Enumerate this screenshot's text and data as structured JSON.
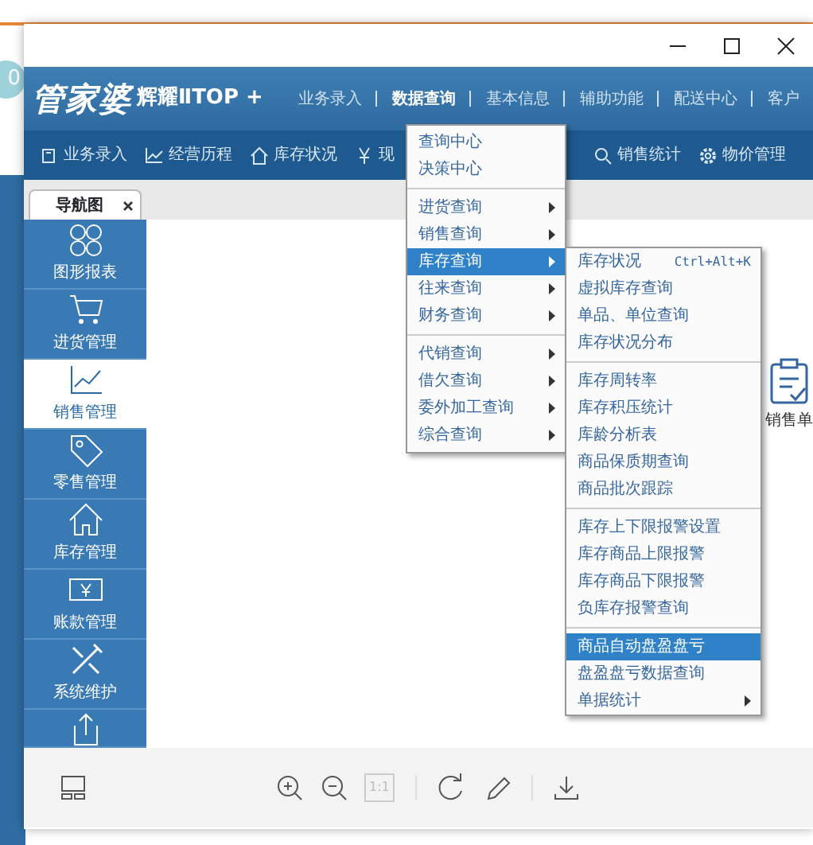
{
  "background": {
    "badge": "0"
  },
  "app": {
    "brand": "管家婆",
    "edition": "辉耀ⅡTOP +",
    "top_menu": [
      {
        "label": "业务录入",
        "selected": false
      },
      {
        "label": "数据查询",
        "selected": true
      },
      {
        "label": "基本信息",
        "selected": false
      },
      {
        "label": "辅助功能",
        "selected": false
      },
      {
        "label": "配送中心",
        "selected": false
      },
      {
        "label": "客户",
        "selected": false
      }
    ],
    "toolbar": [
      {
        "label": "业务录入",
        "kind": "entry"
      },
      {
        "label": "经营历程",
        "kind": "chart"
      },
      {
        "label": "库存状况",
        "kind": "home"
      },
      {
        "label": "现",
        "kind": "yen"
      },
      {
        "label": "销售统计",
        "kind": "search"
      },
      {
        "label": "物价管理",
        "kind": "gear"
      }
    ],
    "tabs": [
      {
        "label": "导航图",
        "selected": true
      }
    ],
    "sidebar": [
      {
        "label": "图形报表",
        "kind": "clover",
        "selected": false
      },
      {
        "label": "进货管理",
        "kind": "cart",
        "selected": false
      },
      {
        "label": "销售管理",
        "kind": "trend",
        "selected": true
      },
      {
        "label": "零售管理",
        "kind": "tag",
        "selected": false
      },
      {
        "label": "库存管理",
        "kind": "home",
        "selected": false
      },
      {
        "label": "账款管理",
        "kind": "money",
        "selected": false
      },
      {
        "label": "系统维护",
        "kind": "tools",
        "selected": false
      },
      {
        "kind": "export",
        "selected": false
      }
    ],
    "shortcut": {
      "label": "销售单"
    }
  },
  "menu": [
    {
      "kind": "item",
      "label": "查询中心",
      "has_submenu": false,
      "selected": false
    },
    {
      "kind": "item",
      "label": "决策中心",
      "has_submenu": false,
      "selected": false
    },
    {
      "kind": "separator"
    },
    {
      "kind": "item",
      "label": "进货查询",
      "has_submenu": true,
      "selected": false
    },
    {
      "kind": "item",
      "label": "销售查询",
      "has_submenu": true,
      "selected": false
    },
    {
      "kind": "item",
      "label": "库存查询",
      "has_submenu": true,
      "selected": true
    },
    {
      "kind": "item",
      "label": "往来查询",
      "has_submenu": true,
      "selected": false
    },
    {
      "kind": "item",
      "label": "财务查询",
      "has_submenu": true,
      "selected": false
    },
    {
      "kind": "separator"
    },
    {
      "kind": "item",
      "label": "代销查询",
      "has_submenu": true,
      "selected": false
    },
    {
      "kind": "item",
      "label": "借欠查询",
      "has_submenu": true,
      "selected": false
    },
    {
      "kind": "item",
      "label": "委外加工查询",
      "has_submenu": true,
      "selected": false
    },
    {
      "kind": "item",
      "label": "综合查询",
      "has_submenu": true,
      "selected": false
    }
  ],
  "submenu": [
    {
      "kind": "item",
      "label": "库存状况",
      "shortcut": "Ctrl+Alt+K",
      "has_submenu": false,
      "selected": false
    },
    {
      "kind": "item",
      "label": "虚拟库存查询",
      "has_submenu": false,
      "selected": false
    },
    {
      "kind": "item",
      "label": "单品、单位查询",
      "has_submenu": false,
      "selected": false
    },
    {
      "kind": "item",
      "label": "库存状况分布",
      "has_submenu": false,
      "selected": false
    },
    {
      "kind": "separator"
    },
    {
      "kind": "item",
      "label": "库存周转率",
      "has_submenu": false,
      "selected": false
    },
    {
      "kind": "item",
      "label": "库存积压统计",
      "has_submenu": false,
      "selected": false
    },
    {
      "kind": "item",
      "label": "库龄分析表",
      "has_submenu": false,
      "selected": false
    },
    {
      "kind": "item",
      "label": "商品保质期查询",
      "has_submenu": false,
      "selected": false
    },
    {
      "kind": "item",
      "label": "商品批次跟踪",
      "has_submenu": false,
      "selected": false
    },
    {
      "kind": "separator"
    },
    {
      "kind": "item",
      "label": "库存上下限报警设置",
      "has_submenu": false,
      "selected": false
    },
    {
      "kind": "item",
      "label": "库存商品上限报警",
      "has_submenu": false,
      "selected": false
    },
    {
      "kind": "item",
      "label": "库存商品下限报警",
      "has_submenu": false,
      "selected": false
    },
    {
      "kind": "item",
      "label": "负库存报警查询",
      "has_submenu": false,
      "selected": false
    },
    {
      "kind": "separator"
    },
    {
      "kind": "item",
      "label": "商品自动盘盈盘亏",
      "has_submenu": false,
      "selected": true
    },
    {
      "kind": "item",
      "label": "盘盈盘亏数据查询",
      "has_submenu": false,
      "selected": false
    },
    {
      "kind": "item",
      "label": "单据统计",
      "has_submenu": true,
      "selected": false
    }
  ],
  "viewer_toolbar": {
    "actual_size": {
      "label": "1:1",
      "disabled": true
    }
  }
}
